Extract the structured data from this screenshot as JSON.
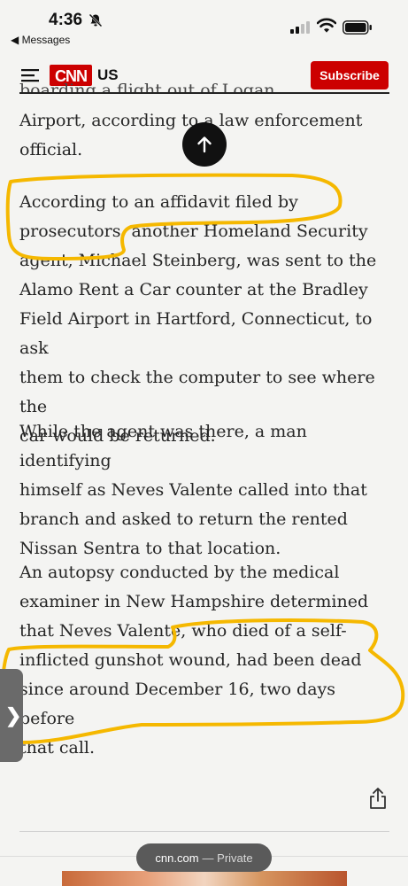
{
  "status_bar": {
    "time": "4:36",
    "back_label": "◀ Messages"
  },
  "header": {
    "logo_text": "CNN",
    "region": "US",
    "subscribe_label": "Subscribe",
    "brand_color": "#cc0000"
  },
  "article": {
    "cutoff_line": "boarding a flight out of Logan International",
    "paragraphs": [
      [
        "Airport, according to a law enforcement",
        "official."
      ],
      [
        "According to an affidavit filed by",
        "prosecutors, another Homeland Security",
        "agent, Michael Steinberg, was sent to the",
        "Alamo Rent a Car counter at the Bradley",
        "Field Airport in Hartford, Connecticut, to ask",
        "them to check the computer to see where the",
        "car would be returned."
      ],
      [
        "While the agent was there, a man identifying",
        "himself as Neves Valente called into that",
        "branch and asked to return the rented",
        "Nissan Sentra to that location."
      ],
      [
        "An autopsy conducted by the medical",
        "examiner in New Hampshire determined",
        "that Neves Valente, who died of a self-",
        "inflicted gunshot wound, had been dead",
        "since around December 16, two days before",
        "that call."
      ]
    ]
  },
  "annotation_color": "#f5b800",
  "browser": {
    "url": "cnn.com",
    "mode": "— Private"
  },
  "icons": [
    "bell-muted-icon",
    "signal-icon",
    "wifi-icon",
    "battery-icon",
    "hamburger-icon",
    "scroll-to-top-icon",
    "side-tab-chevron-icon",
    "share-icon"
  ]
}
